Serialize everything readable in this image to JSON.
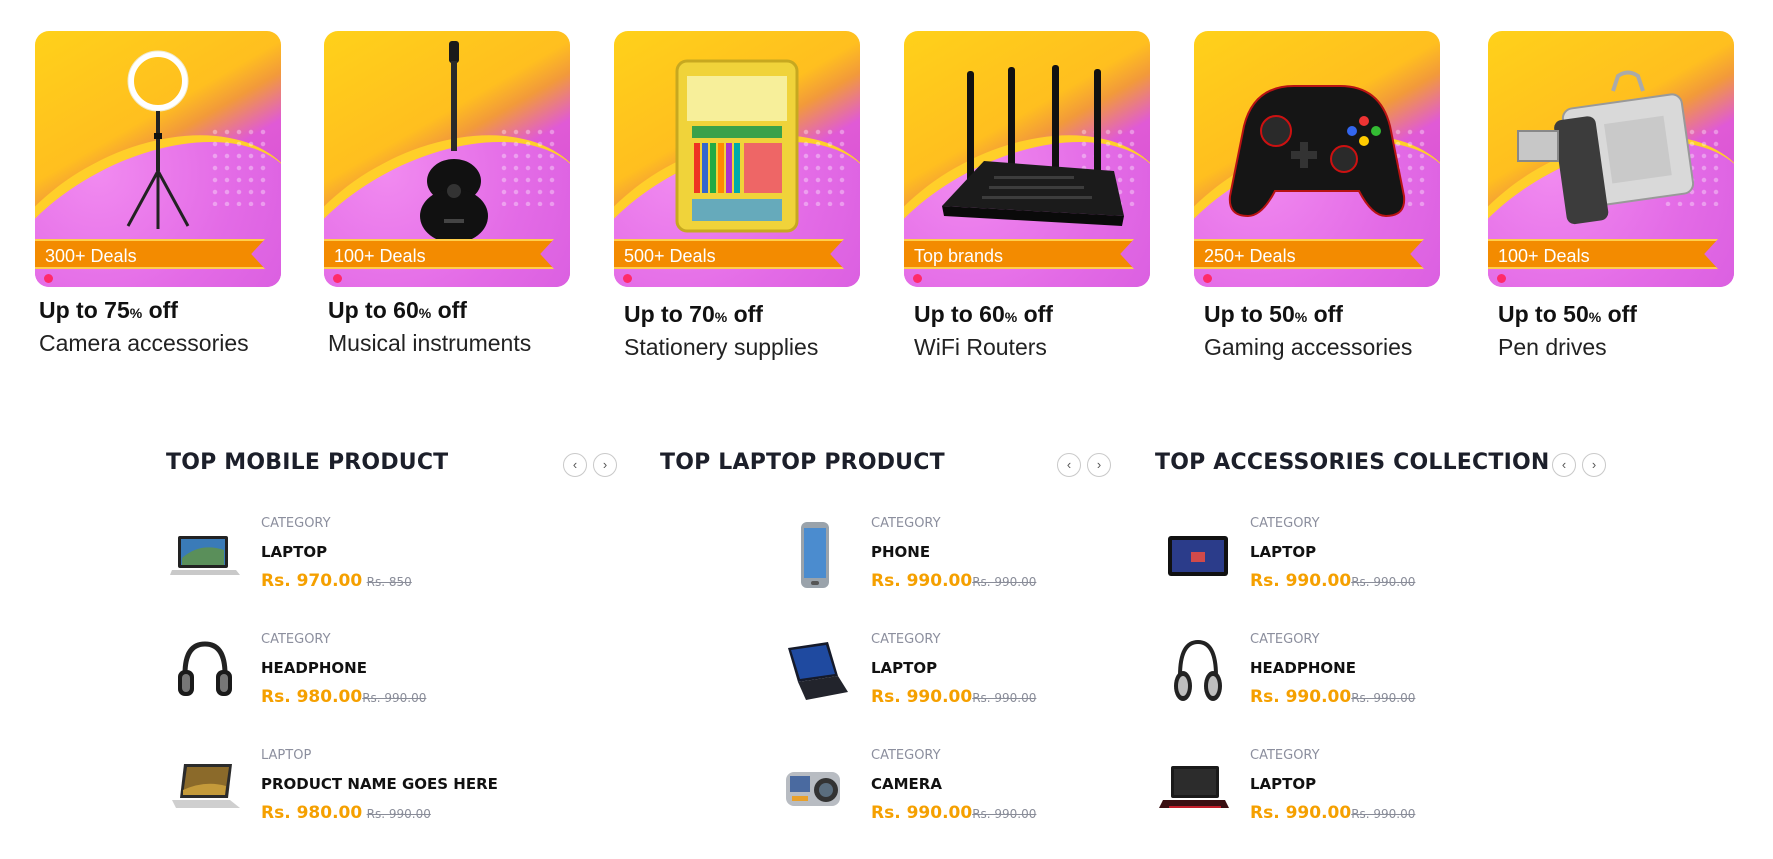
{
  "deals": [
    {
      "tag": "300+ Deals",
      "discount_main": "Up to 75",
      "discount_pct": "%",
      "discount_off": " off",
      "category": "Camera accessories",
      "image_icon": "ring-light-icon"
    },
    {
      "tag": "100+ Deals",
      "discount_main": "Up to 60",
      "discount_pct": "%",
      "discount_off": " off",
      "category": "Musical instruments",
      "image_icon": "guitar-icon"
    },
    {
      "tag": "500+ Deals",
      "discount_main": "Up to 70",
      "discount_pct": "%",
      "discount_off": " off",
      "category": "Stationery supplies",
      "image_icon": "stationery-kit-icon"
    },
    {
      "tag": "Top brands",
      "discount_main": "Up to 60",
      "discount_pct": "%",
      "discount_off": " off",
      "category": "WiFi Routers",
      "image_icon": "router-icon"
    },
    {
      "tag": "250+ Deals",
      "discount_main": "Up to 50",
      "discount_pct": "%",
      "discount_off": " off",
      "category": "Gaming accessories",
      "image_icon": "gamepad-icon"
    },
    {
      "tag": "100+ Deals",
      "discount_main": "Up to 50",
      "discount_pct": "%",
      "discount_off": " off",
      "category": "Pen drives",
      "image_icon": "usb-drive-icon"
    }
  ],
  "columns": [
    {
      "title": "TOP MOBILE PRODUCT",
      "prev": "‹",
      "next": "›",
      "items": [
        {
          "category": "CATEGORY",
          "name": "LAPTOP",
          "price": "Rs. 970.00",
          "old_price": "Rs. 850",
          "icon": "laptop-icon"
        },
        {
          "category": "CATEGORY",
          "name": "HEADPHONE",
          "price": "Rs. 980.00",
          "old_price": "Rs. 990.00",
          "icon": "headphone-icon"
        },
        {
          "category": "LAPTOP",
          "name": "PRODUCT NAME GOES HERE",
          "price": "Rs. 980.00",
          "old_price": "Rs. 990.00",
          "icon": "laptop-icon"
        }
      ]
    },
    {
      "title": "TOP LAPTOP PRODUCT",
      "prev": "‹",
      "next": "›",
      "items": [
        {
          "category": "CATEGORY",
          "name": "PHONE",
          "price": "Rs. 990.00",
          "old_price": "Rs. 990.00",
          "icon": "phone-icon"
        },
        {
          "category": "CATEGORY",
          "name": "LAPTOP",
          "price": "Rs. 990.00",
          "old_price": "Rs. 990.00",
          "icon": "laptop-icon"
        },
        {
          "category": "CATEGORY",
          "name": "CAMERA",
          "price": "Rs. 990.00",
          "old_price": "Rs. 990.00",
          "icon": "camera-icon"
        }
      ]
    },
    {
      "title": "TOP ACCESSORIES COLLECTION",
      "prev": "‹",
      "next": "›",
      "items": [
        {
          "category": "CATEGORY",
          "name": "LAPTOP",
          "price": "Rs. 990.00",
          "old_price": "Rs. 990.00",
          "icon": "tablet-icon"
        },
        {
          "category": "CATEGORY",
          "name": "HEADPHONE",
          "price": "Rs. 990.00",
          "old_price": "Rs. 990.00",
          "icon": "headphone-icon"
        },
        {
          "category": "CATEGORY",
          "name": "LAPTOP",
          "price": "Rs. 990.00",
          "old_price": "Rs. 990.00",
          "icon": "laptop-icon"
        }
      ]
    }
  ],
  "colors": {
    "price": "#f5a000",
    "tag": "#f38b00",
    "heading": "#1c1f2a"
  }
}
